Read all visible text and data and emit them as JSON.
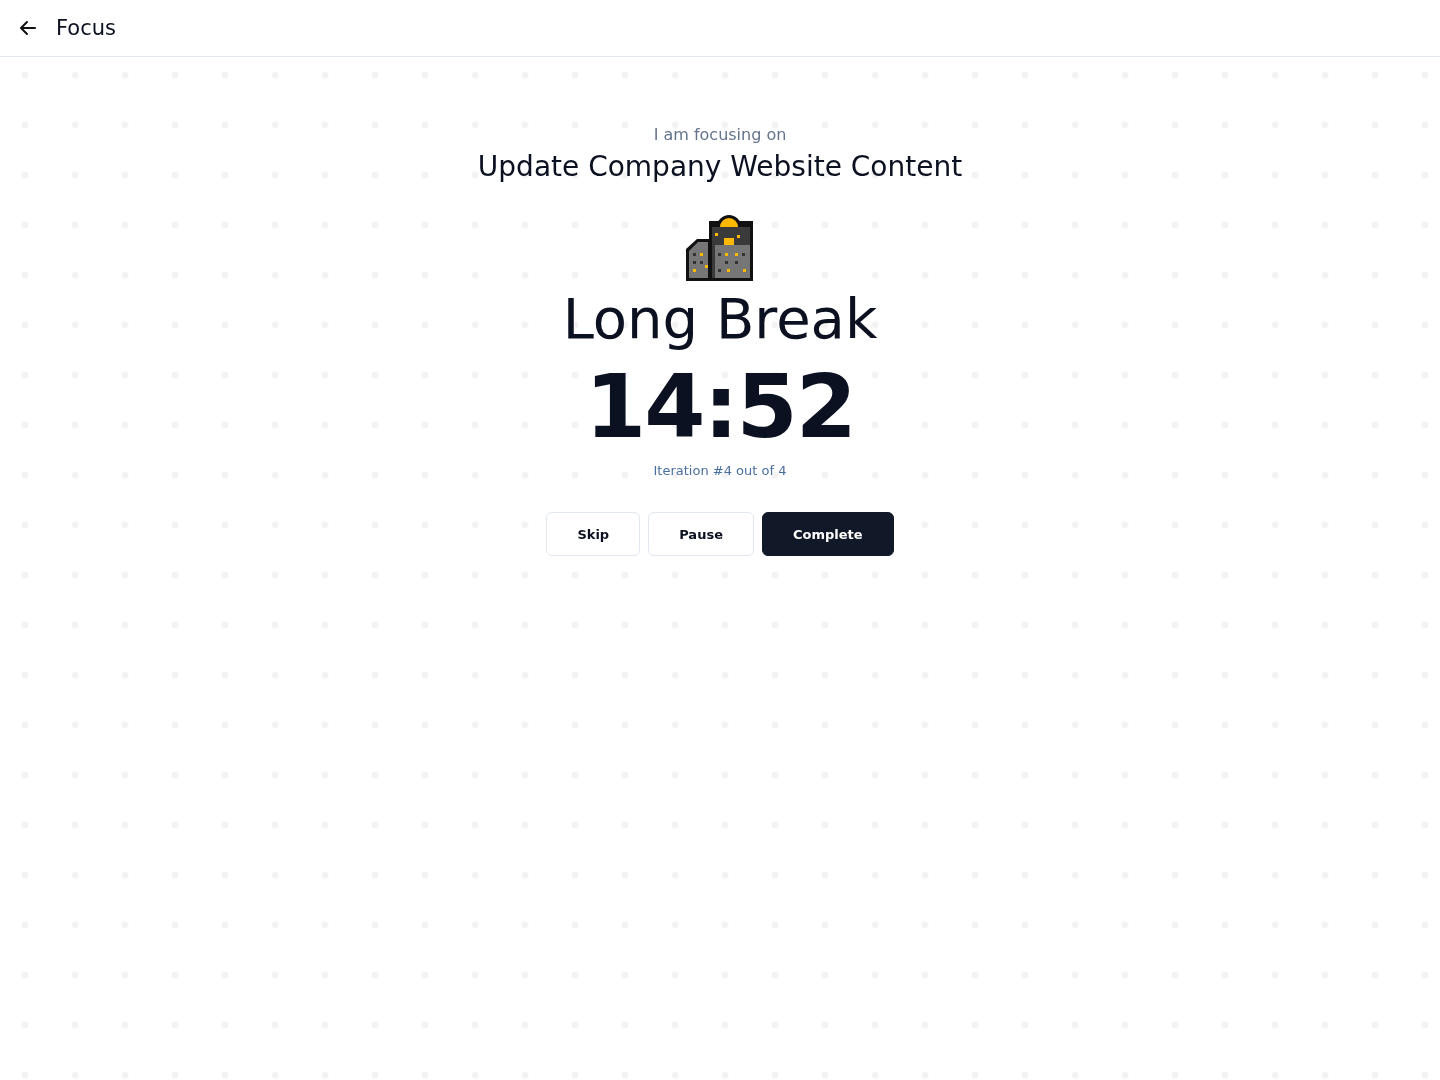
{
  "header": {
    "title": "Focus"
  },
  "task": {
    "label": "I am focusing on",
    "title": "Update Company Website Content"
  },
  "session": {
    "name": "Long Break",
    "timer": "14:52",
    "iteration": "Iteration #4 out of 4"
  },
  "buttons": [
    {
      "label": "Skip",
      "kind": "outline"
    },
    {
      "label": "Pause",
      "kind": "outline"
    },
    {
      "label": "Complete",
      "kind": "primary"
    }
  ]
}
